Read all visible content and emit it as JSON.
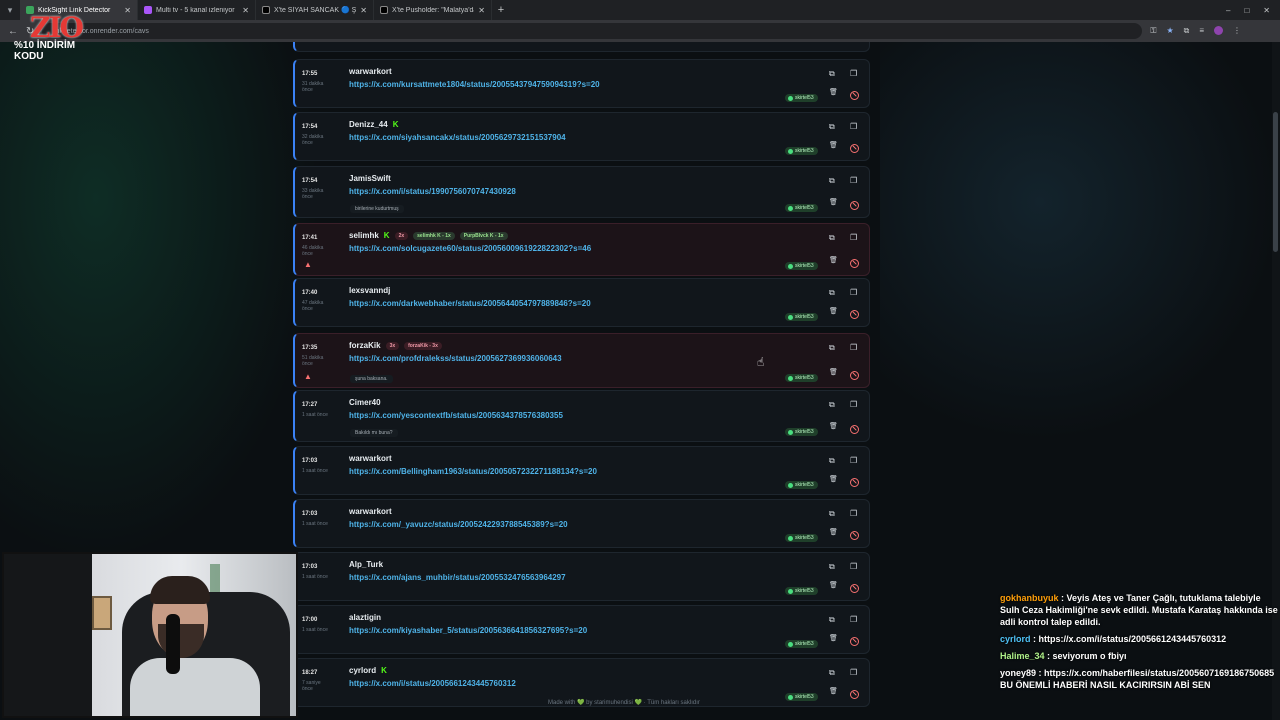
{
  "browser": {
    "tabs": [
      {
        "title": "KickSight Link Detector",
        "active": true,
        "favicon": "kick"
      },
      {
        "title": "Multi tv - 5 kanal izleniyor",
        "active": false,
        "favicon": "multitv"
      },
      {
        "title": "X'te SİYAH SANCAK 🔵 Şehit",
        "active": false,
        "favicon": "x"
      },
      {
        "title": "X'te Pusholder: \"Malatya'da",
        "active": false,
        "favicon": "x"
      }
    ],
    "address": "linkdetector.onrender.com/cavs",
    "new_tab": "+",
    "window_controls": [
      "–",
      "□",
      "✕"
    ]
  },
  "overlay": {
    "logo_mark": "ZIO",
    "logo_sub": "%10 İNDİRİM KODU"
  },
  "feed": {
    "badge_label": "skirtel53",
    "cards": [
      {
        "time": "17:55",
        "ago": "31 dakika önce",
        "user": "warwarkort",
        "kick": false,
        "pills": [],
        "link": "https://x.com/kursattmete1804/status/2005543794759094319?s=20",
        "note": "",
        "flagged": false
      },
      {
        "time": "17:54",
        "ago": "32 dakika önce",
        "user": "Denizz_44",
        "kick": true,
        "pills": [],
        "link": "https://x.com/siyahsancakx/status/2005629732151537904",
        "note": "",
        "flagged": false
      },
      {
        "time": "17:54",
        "ago": "33 dakika önce",
        "user": "JamisSwift",
        "kick": false,
        "pills": [],
        "link": "https://x.com/i/status/1990756070747430928",
        "note": "birilerine kudurtmuş",
        "flagged": false
      },
      {
        "time": "17:41",
        "ago": "46 dakika önce",
        "user": "selimhk",
        "kick": true,
        "pills": [
          {
            "text": "2x",
            "style": "red"
          },
          {
            "text": "selimhk K - 1x",
            "style": "green"
          },
          {
            "text": "PurpBlvck K - 1x",
            "style": "green"
          }
        ],
        "link": "https://x.com/solcugazete60/status/2005600961922822302?s=46",
        "note": "",
        "flagged": true
      },
      {
        "time": "17:40",
        "ago": "47 dakika önce",
        "user": "lexsvanndj",
        "kick": false,
        "pills": [],
        "link": "https://x.com/darkwebhaber/status/2005644054797889846?s=20",
        "note": "",
        "flagged": false
      },
      {
        "time": "17:35",
        "ago": "51 dakika önce",
        "user": "forzaKik",
        "kick": false,
        "pills": [
          {
            "text": "3x",
            "style": "red"
          },
          {
            "text": "forzaKik - 3x",
            "style": "red"
          }
        ],
        "link": "https://x.com/profdralekss/status/2005627369936060643",
        "note": "şuna baksana.",
        "flagged": true
      },
      {
        "time": "17:27",
        "ago": "1 saat önce",
        "user": "Cimer40",
        "kick": false,
        "pills": [],
        "link": "https://x.com/yescontextfb/status/2005634378576380355",
        "note": "Bakıldı mı buna?",
        "flagged": false
      },
      {
        "time": "17:03",
        "ago": "1 saat önce",
        "user": "warwarkort",
        "kick": false,
        "pills": [],
        "link": "https://x.com/Bellingham1963/status/2005057232271188134?s=20",
        "note": "",
        "flagged": false
      },
      {
        "time": "17:03",
        "ago": "1 saat önce",
        "user": "warwarkort",
        "kick": false,
        "pills": [],
        "link": "https://x.com/_yavuzc/status/2005242293788545389?s=20",
        "note": "",
        "flagged": false
      },
      {
        "time": "17:03",
        "ago": "1 saat önce",
        "user": "Alp_Turk",
        "kick": false,
        "pills": [],
        "link": "https://x.com/ajans_muhbir/status/2005532476563964297",
        "note": "",
        "flagged": false
      },
      {
        "time": "17:00",
        "ago": "1 saat önce",
        "user": "alaztigin",
        "kick": false,
        "pills": [],
        "link": "https://x.com/kiyashaber_5/status/2005636641856327695?s=20",
        "note": "",
        "flagged": false
      },
      {
        "time": "18:27",
        "ago": "7 saniye önce",
        "user": "cyrlord",
        "kick": true,
        "pills": [],
        "link": "https://x.com/i/status/2005661243445760312",
        "note": "",
        "flagged": false
      }
    ],
    "footer": "Made with 💚 by starimuhendisi 💚 · Tüm hakları saklıdır"
  },
  "chat": [
    {
      "user": "gokhanbuyuk",
      "message": "Veyis Ateş ve Taner Çağlı, tutuklama talebiyle Sulh Ceza Hakimliği'ne sevk edildi. Mustafa Karataş hakkında ise adli kontrol talep edildi.",
      "color": "#ff9f0a"
    },
    {
      "user": "cyrlord",
      "message": "https://x.com/i/status/2005661243445760312",
      "color": "#4fc3f7"
    },
    {
      "user": "Halime_34",
      "message": "seviyorum o fbiyı",
      "color": "#b0f28a"
    },
    {
      "user": "yoney89",
      "message": "https://x.com/haberfilesi/status/2005607169186750685 BU ÖNEMLİ HABERİ NASIL KACIRIRSIN ABİ SEN",
      "color": "#ffffff"
    }
  ]
}
